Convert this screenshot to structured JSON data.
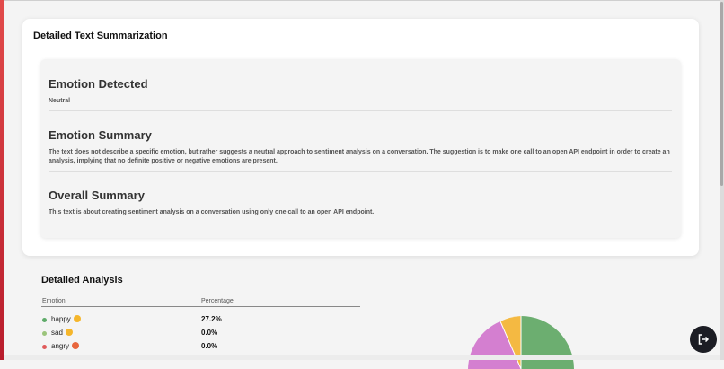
{
  "summary_card": {
    "title": "Detailed Text Summarization",
    "emotion_detected_title": "Emotion Detected",
    "emotion_detected_value": "Neutral",
    "emotion_summary_title": "Emotion Summary",
    "emotion_summary_text": "The text does not describe a specific emotion, but rather suggests a neutral approach to sentiment analysis on a conversation. The suggestion is to make one call to an open API endpoint in order to create an analysis, implying that no definite positive or negative emotions are present.",
    "overall_summary_title": "Overall Summary",
    "overall_summary_text": "This text is about creating sentiment analysis on a conversation using only one call to an open API endpoint."
  },
  "analysis": {
    "title": "Detailed Analysis",
    "col_emotion": "Emotion",
    "col_percentage": "Percentage",
    "rows": [
      {
        "label": "happy",
        "percentage": "27.2%",
        "color": "#5fab6a",
        "icon": "happy-emoji-icon"
      },
      {
        "label": "sad",
        "percentage": "0.0%",
        "color": "#9bc47b",
        "icon": "sad-emoji-icon"
      },
      {
        "label": "angry",
        "percentage": "0.0%",
        "color": "#e05b5b",
        "icon": "angry-emoji-icon"
      }
    ]
  },
  "pie_colors": {
    "happy": "#6cae70",
    "purple": "#d47fd0",
    "orange": "#f4b942"
  },
  "fab_icon": "logout-icon"
}
